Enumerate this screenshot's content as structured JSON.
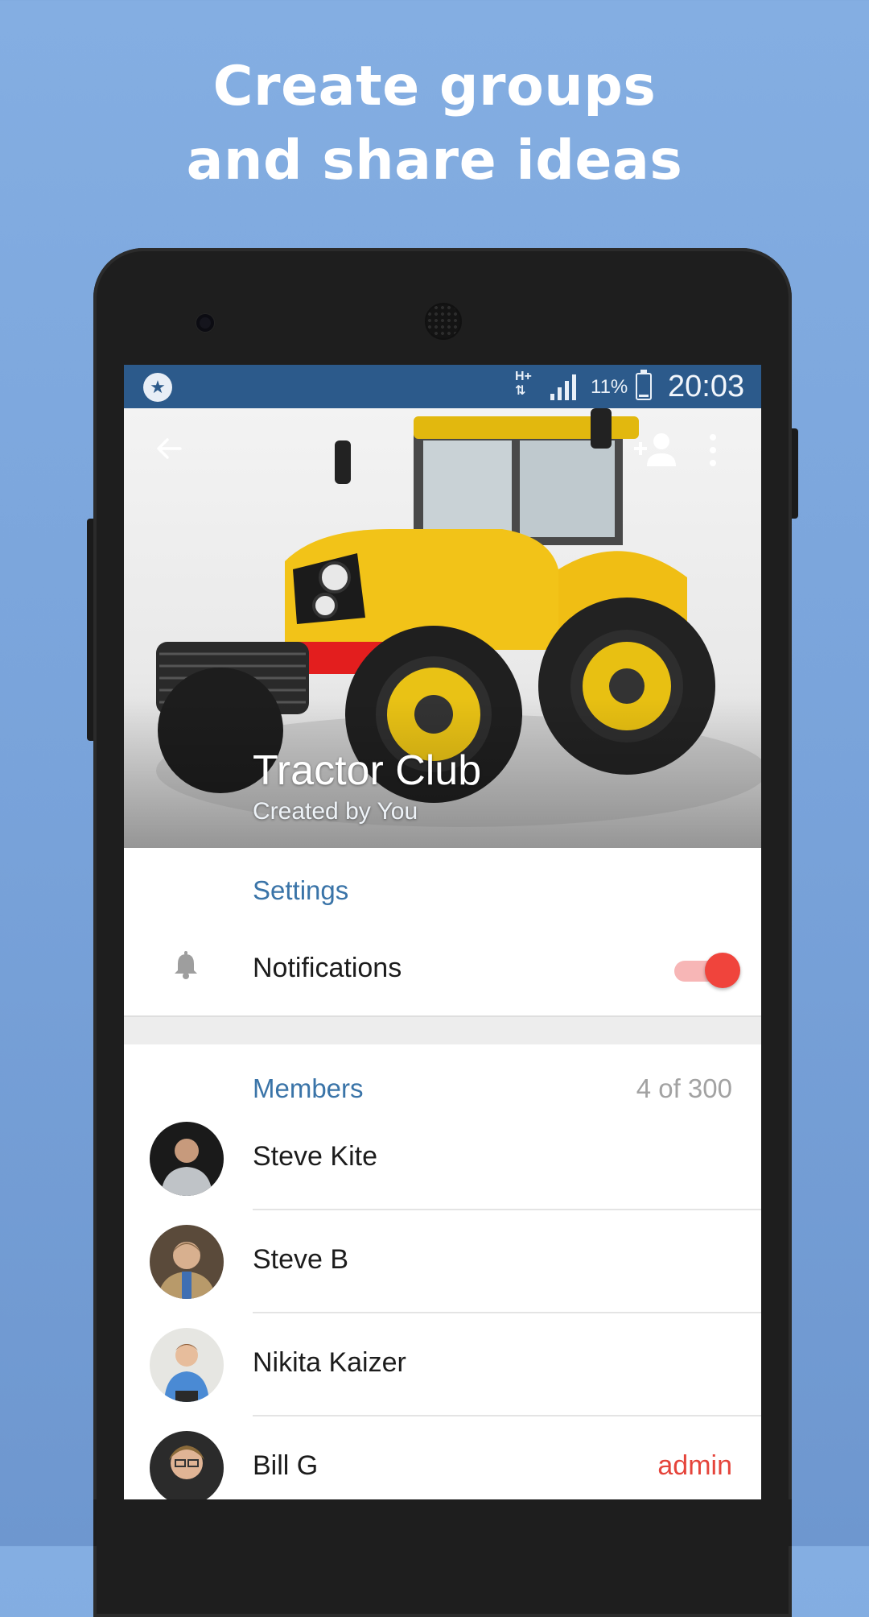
{
  "promo": {
    "headline_line1": "Create groups",
    "headline_line2": "and share ideas"
  },
  "status_bar": {
    "network": "H+",
    "battery_percent": "11%",
    "battery_level": 0.11,
    "time": "20:03"
  },
  "header": {
    "group_name": "Tractor Club",
    "subtitle": "Created by You",
    "icons": [
      "back-arrow-icon",
      "add-member-icon",
      "more-vert-icon"
    ]
  },
  "settings": {
    "section_label": "Settings",
    "notifications_label": "Notifications",
    "notifications_enabled": true
  },
  "members": {
    "section_label": "Members",
    "count_text": "4 of 300",
    "list": [
      {
        "name": "Steve Kite",
        "role": ""
      },
      {
        "name": "Steve B",
        "role": ""
      },
      {
        "name": "Nikita Kaizer",
        "role": ""
      },
      {
        "name": "Bill G",
        "role": "admin"
      }
    ]
  },
  "colors": {
    "background": "#7ca6dc",
    "status_bar": "#2c5a8b",
    "section_header": "#3a74a8",
    "toggle_on": "#f0443c",
    "admin_badge": "#e5443b"
  }
}
